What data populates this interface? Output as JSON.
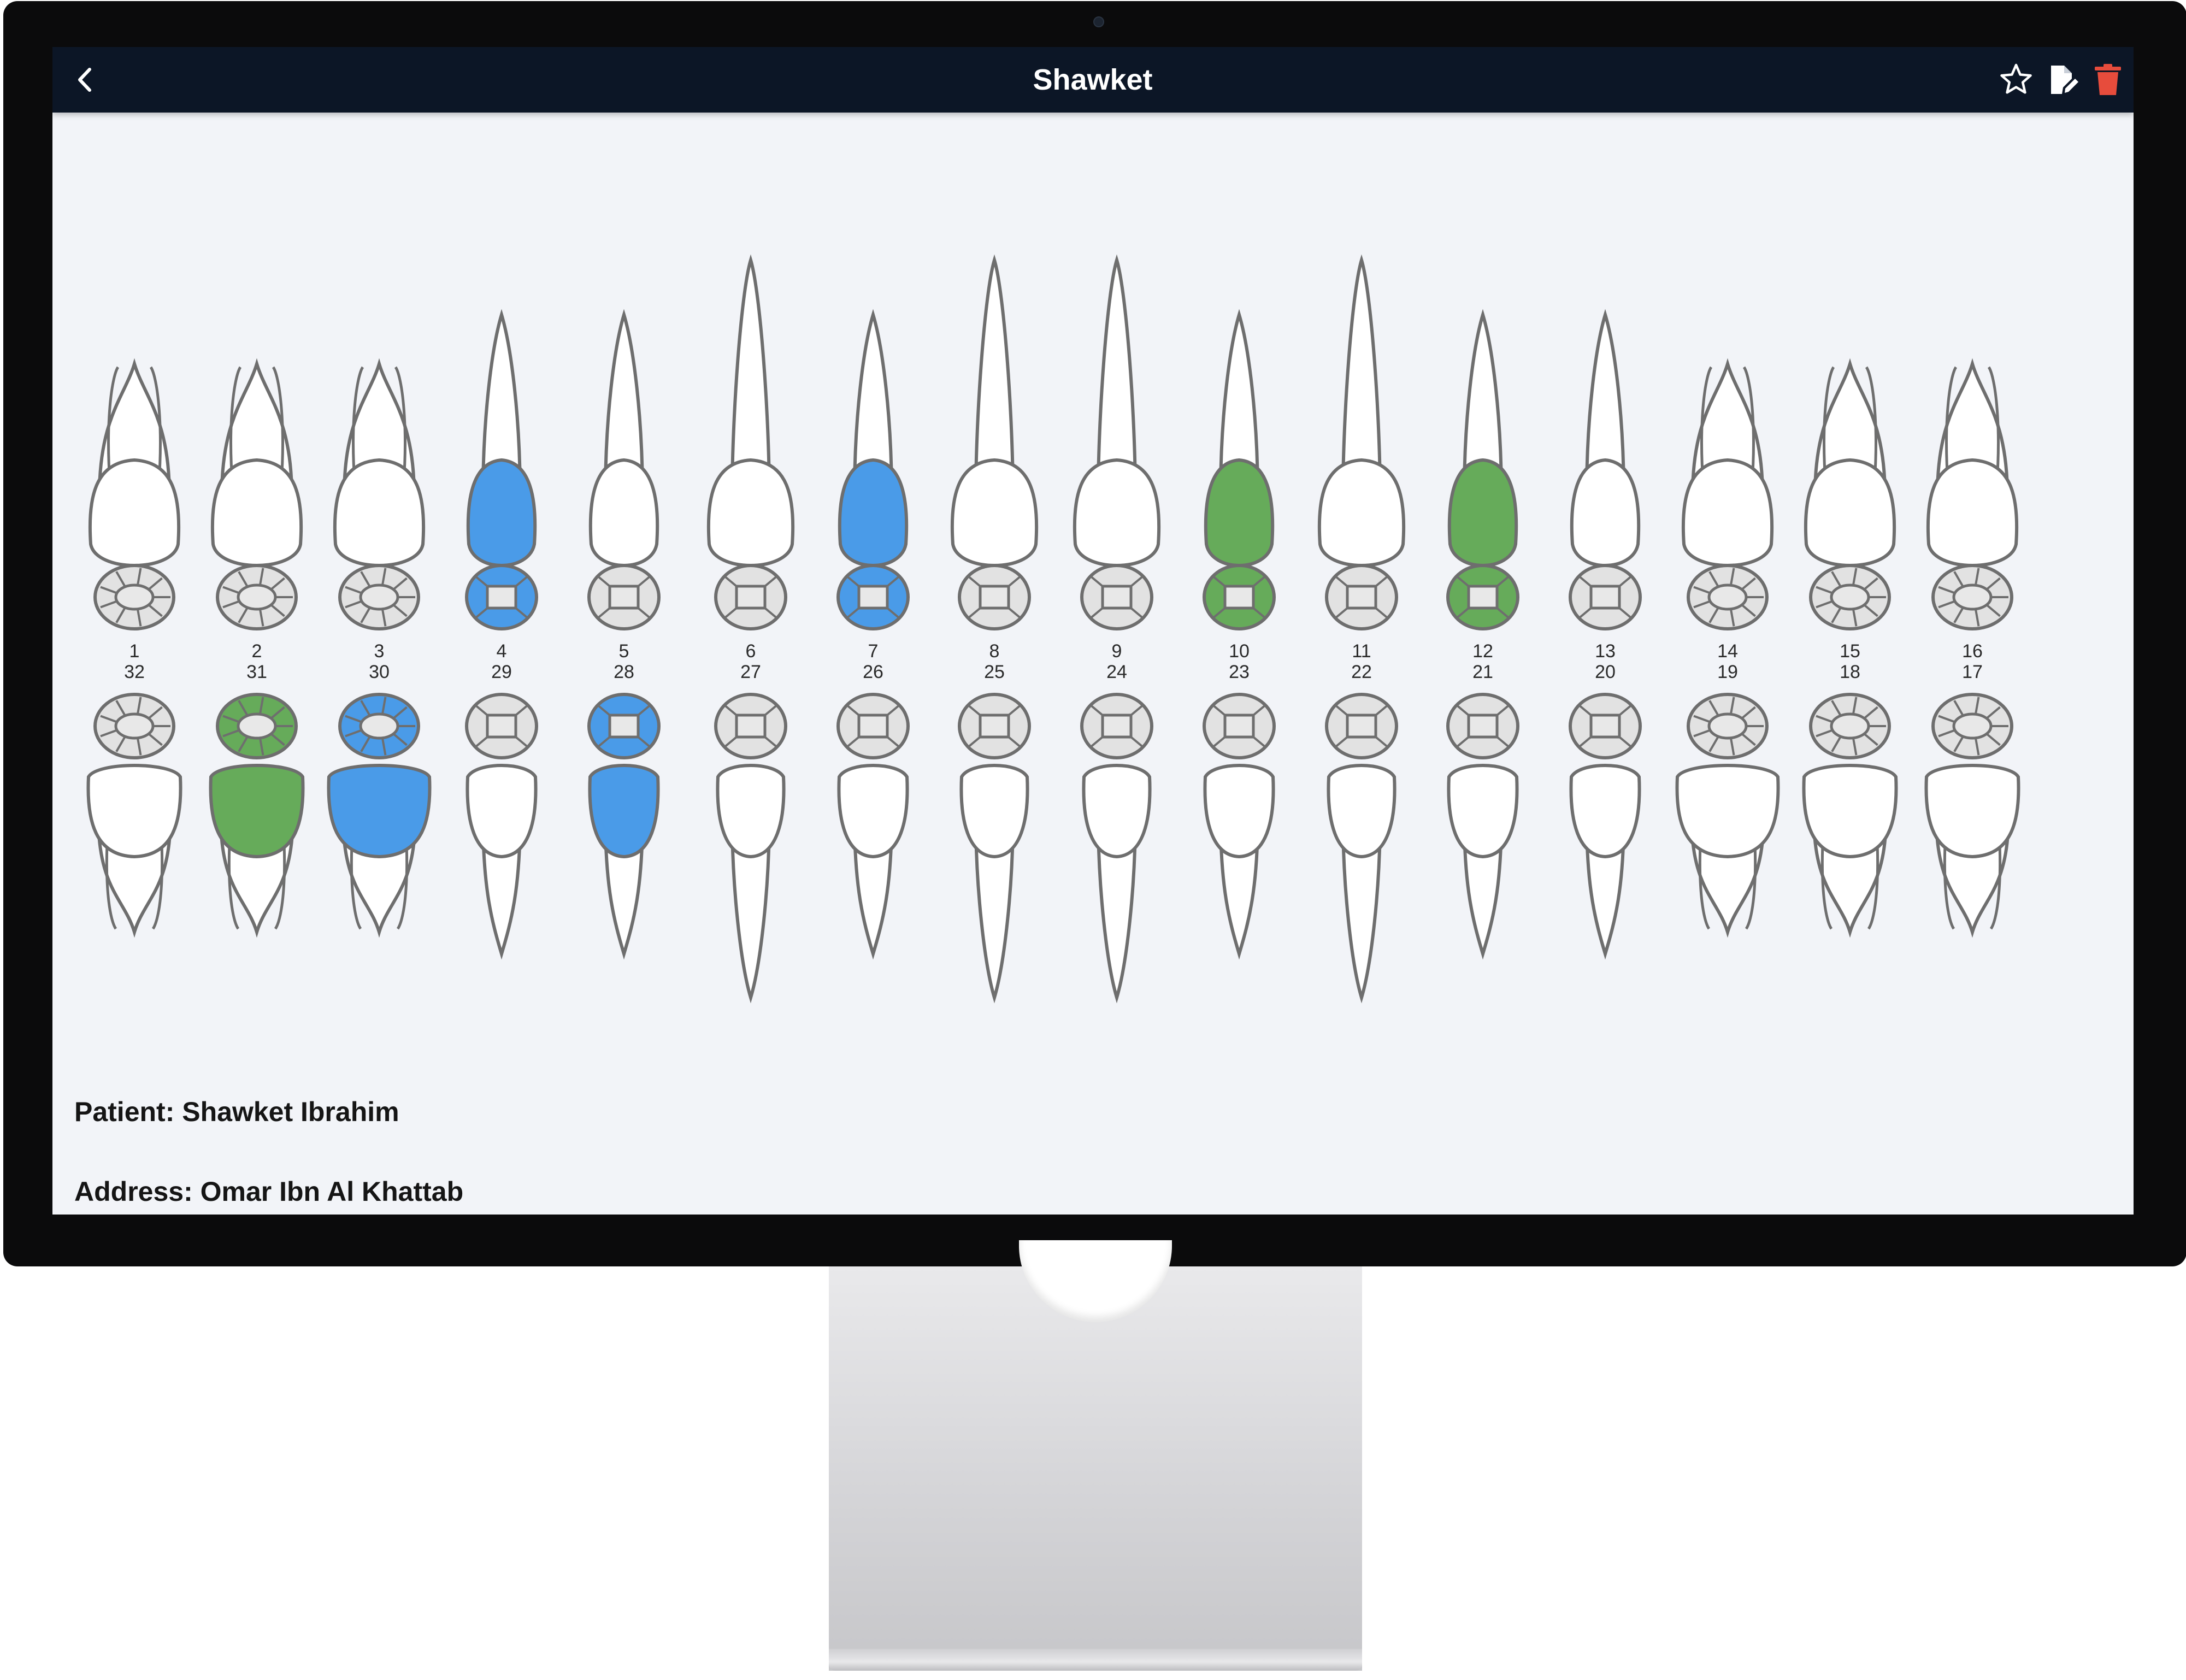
{
  "appbar": {
    "title": "Shawket",
    "background": "#0c1626",
    "delete_color": "#e74c3c",
    "icons": [
      "chevron-left-icon",
      "star-icon",
      "edit-document-icon",
      "trash-icon"
    ]
  },
  "teeth": {
    "upper_numbers": [
      "1",
      "2",
      "3",
      "4",
      "5",
      "6",
      "7",
      "8",
      "9",
      "10",
      "11",
      "12",
      "13",
      "14",
      "15",
      "16"
    ],
    "lower_numbers": [
      "32",
      "31",
      "30",
      "29",
      "28",
      "27",
      "26",
      "25",
      "24",
      "23",
      "22",
      "21",
      "20",
      "19",
      "18",
      "17"
    ],
    "colors": {
      "blue": "#4a9be8",
      "green": "#66ab5a",
      "outline": "#6e6e6e",
      "occlusal": "#e2e2e2"
    },
    "upper_marks": [
      {
        "number": "4",
        "crown": "blue",
        "occlusal": "blue"
      },
      {
        "number": "7",
        "crown": "blue",
        "occlusal": "blue"
      },
      {
        "number": "10",
        "crown": "green",
        "occlusal": "green"
      },
      {
        "number": "12",
        "crown": "green",
        "occlusal": "green"
      }
    ],
    "lower_marks": [
      {
        "number": "31",
        "crown": "green",
        "occlusal": "green"
      },
      {
        "number": "30",
        "crown": "blue",
        "occlusal": "blue"
      },
      {
        "number": "28",
        "crown": "blue",
        "occlusal": "blue"
      }
    ]
  },
  "patient": {
    "name_line": "Patient: Shawket Ibrahim",
    "address_line": "Address: Omar Ibn Al Khattab"
  }
}
